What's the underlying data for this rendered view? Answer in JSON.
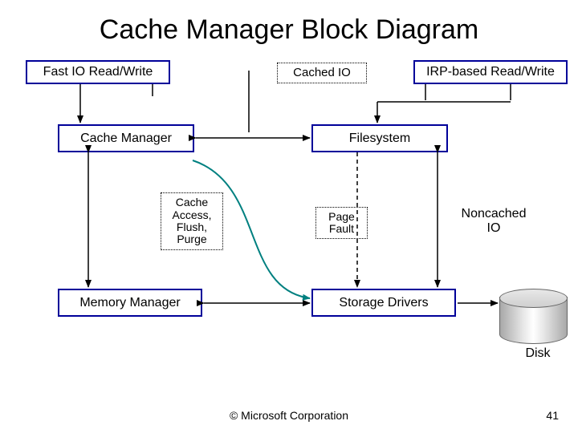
{
  "title": "Cache Manager Block Diagram",
  "boxes": {
    "fast_io": "Fast IO Read/Write",
    "cached_io": "Cached IO",
    "irp": "IRP-based Read/Write",
    "cache_manager": "Cache Manager",
    "filesystem": "Filesystem",
    "cache_access": "Cache\nAccess,\nFlush,\nPurge",
    "page_fault": "Page\nFault",
    "noncached_io": "Noncached\nIO",
    "memory_manager": "Memory Manager",
    "storage_drivers": "Storage Drivers",
    "disk": "Disk"
  },
  "footer": {
    "copyright": "© Microsoft Corporation",
    "page": "41"
  },
  "colors": {
    "box_border": "#000099",
    "curve": "#008080"
  }
}
